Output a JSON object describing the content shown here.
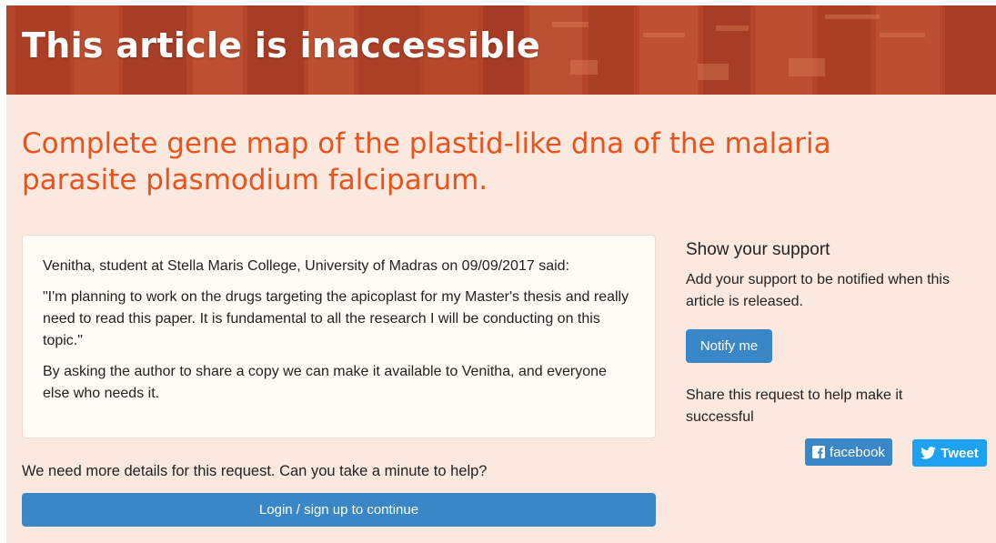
{
  "banner": {
    "title": "This article is inaccessible"
  },
  "article": {
    "title": "Complete gene map of the plastid-like dna of the malaria parasite plasmodium falciparum."
  },
  "request": {
    "said_line": "Venitha, student at Stella Maris College, University of Madras on 09/09/2017 said:",
    "quote": "\"I'm planning to work on the drugs targeting the apicoplast for my Master's thesis and really need to read this paper. It is fundamental to all the research I will be conducting on this topic.\"",
    "appeal": "By asking the author to share a copy we can make it available to Venitha, and everyone else who needs it."
  },
  "details": {
    "question": "We need more details for this request. Can you take a minute to help?",
    "login_label": "Login / sign up to continue"
  },
  "support": {
    "heading": "Show your support",
    "text": "Add your support to be notified when this article is released.",
    "notify_label": "Notify me",
    "share_text": "Share this request to help make it successful",
    "facebook_label": "facebook",
    "tweet_label": "Tweet"
  },
  "colors": {
    "banner": "#b9462a",
    "page_background": "#fbe8df",
    "title_orange": "#e8541e",
    "button_blue": "#3a87c8",
    "twitter_blue": "#1da1f2"
  },
  "icons": [
    "facebook-icon",
    "twitter-bird-icon"
  ]
}
